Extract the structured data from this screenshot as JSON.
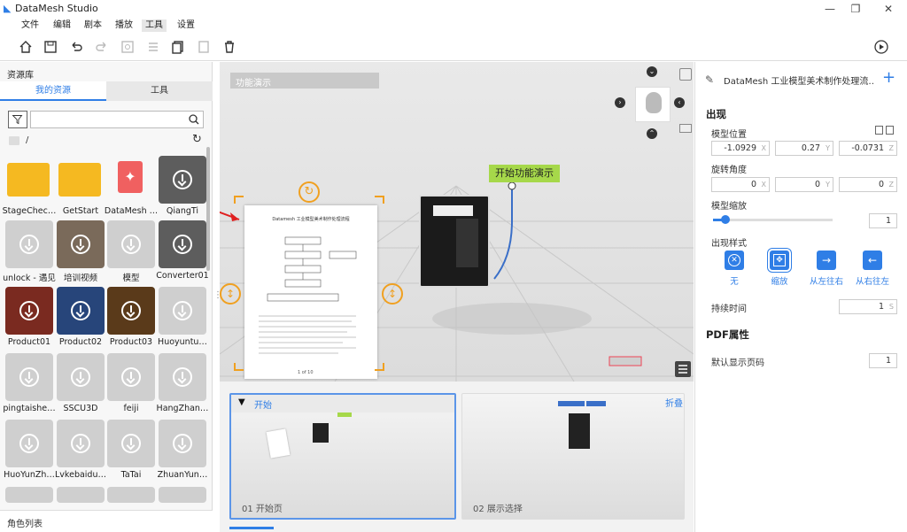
{
  "app": {
    "title": "DataMesh Studio"
  },
  "menu": [
    "文件",
    "编辑",
    "剧本",
    "播放",
    "工具",
    "设置"
  ],
  "left_panel": {
    "title": "资源库",
    "tabs": [
      "我的资源",
      "工具"
    ],
    "search_placeholder": "",
    "path": "/",
    "assets": [
      "StageChec…",
      "GetStart",
      "DataMesh …",
      "QiangTi",
      "unlock - 遇见",
      "培训视频",
      "模型",
      "Converter01",
      "Product01",
      "Product02",
      "Product03",
      "Huoyuntu…",
      "pingtaishe…",
      "SSCU3D",
      "feiji",
      "HangZhan…",
      "HuoYunZh…",
      "Lvkebaidu…",
      "TaTai",
      "ZhuanYun…"
    ],
    "footer": "角色列表"
  },
  "viewport": {
    "label": "功能演示",
    "callout": "开始功能演示",
    "pdf_page": "1 of 10",
    "pdf_title": "Datamesh 工业模型美术制作处理流程"
  },
  "timeline": {
    "scene1_header": "开始",
    "scene1_caption": "01 开始页",
    "scene2_caption": "02 展示选择",
    "collapse": "折叠"
  },
  "right_panel": {
    "header": "DataMesh 工业模型美术制作处理流…",
    "section_appear": "出现",
    "model_position": "模型位置",
    "pos": [
      "-1.0929",
      "0.27",
      "-0.0731"
    ],
    "rotation": "旋转角度",
    "rot": [
      "0",
      "0",
      "0"
    ],
    "scale": "模型缩放",
    "scale_value": "1",
    "scale_fraction": 0.1,
    "appear_style": "出现样式",
    "styles": [
      "无",
      "缩放",
      "从左往右",
      "从右往左"
    ],
    "duration_label": "持续时间",
    "duration": "1",
    "duration_unit": "S",
    "section_pdf": "PDF属性",
    "default_page_label": "默认显示页码",
    "default_page": "1",
    "axes": [
      "X",
      "Y",
      "Z"
    ]
  },
  "colors": {
    "accent": "#2f7ee6",
    "callout": "#a6d84a",
    "pdf_frame": "#f0a020",
    "arrow": "#e02020"
  }
}
